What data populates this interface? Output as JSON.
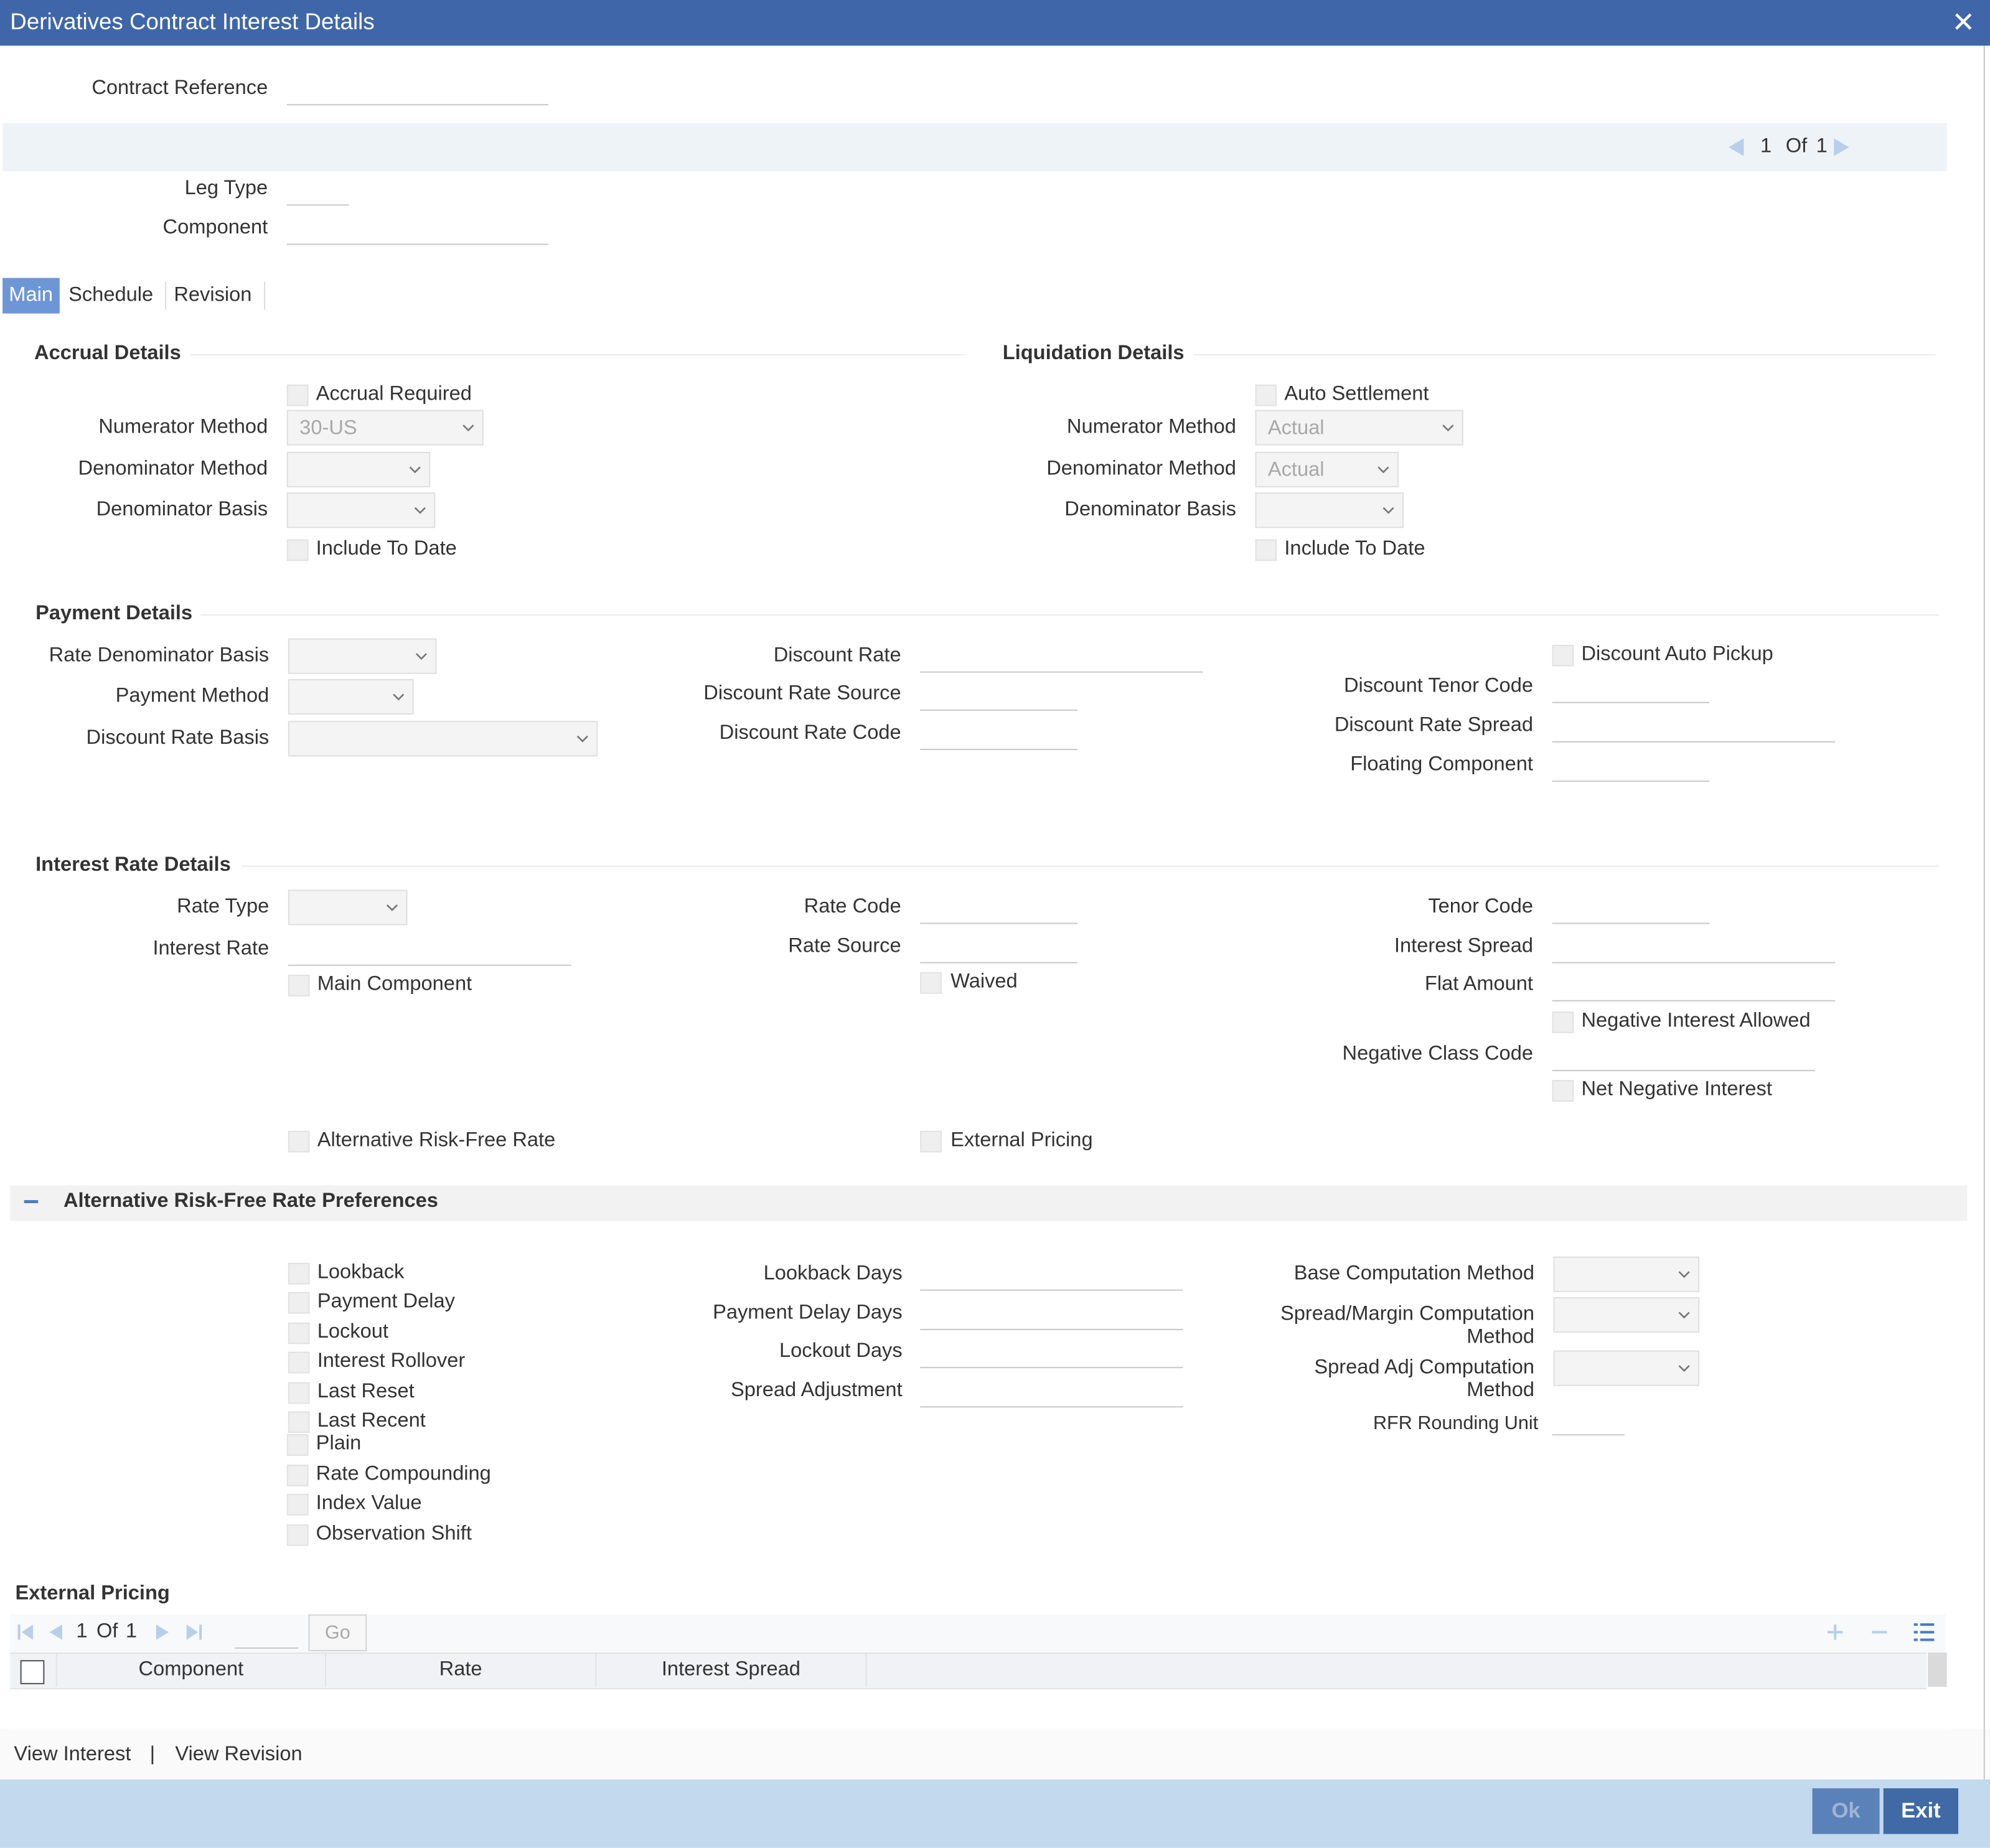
{
  "window": {
    "title": "Derivatives Contract Interest Details",
    "close_glyph": "✕"
  },
  "header": {
    "contract_reference_label": "Contract Reference",
    "leg_type_label": "Leg Type",
    "component_label": "Component",
    "pager": {
      "current": "1",
      "of": "Of",
      "total": "1"
    }
  },
  "tabs": [
    {
      "label": "Main"
    },
    {
      "label": "Schedule"
    },
    {
      "label": "Revision"
    }
  ],
  "accrual": {
    "title": "Accrual Details",
    "accrual_required": "Accrual Required",
    "numerator_method": "Numerator Method",
    "numerator_value": "30-US",
    "denominator_method": "Denominator Method",
    "denominator_basis": "Denominator Basis",
    "include_to_date": "Include To Date"
  },
  "liquidation": {
    "title": "Liquidation Details",
    "auto_settlement": "Auto Settlement",
    "numerator_method": "Numerator Method",
    "numerator_value": "Actual",
    "denominator_method": "Denominator Method",
    "denominator_value": "Actual",
    "denominator_basis": "Denominator Basis",
    "include_to_date": "Include To Date"
  },
  "payment": {
    "title": "Payment Details",
    "rate_denominator_basis": "Rate Denominator Basis",
    "payment_method": "Payment Method",
    "discount_rate_basis": "Discount Rate Basis",
    "discount_rate": "Discount Rate",
    "discount_rate_source": "Discount Rate Source",
    "discount_rate_code": "Discount Rate Code",
    "discount_auto_pickup": "Discount Auto Pickup",
    "discount_tenor_code": "Discount Tenor Code",
    "discount_rate_spread": "Discount Rate Spread",
    "floating_component": "Floating Component"
  },
  "interest": {
    "title": "Interest Rate Details",
    "rate_type": "Rate Type",
    "interest_rate": "Interest Rate",
    "main_component": "Main Component",
    "rate_code": "Rate Code",
    "rate_source": "Rate Source",
    "waived": "Waived",
    "tenor_code": "Tenor Code",
    "interest_spread": "Interest Spread",
    "flat_amount": "Flat Amount",
    "negative_interest_allowed": "Negative Interest Allowed",
    "negative_class_code": "Negative Class Code",
    "net_negative_interest": "Net Negative Interest",
    "alternative_rfr": "Alternative Risk-Free Rate",
    "external_pricing": "External Pricing"
  },
  "rfr": {
    "title": "Alternative Risk-Free Rate Preferences",
    "collapse_glyph": "−",
    "checks": [
      "Lookback",
      "Payment Delay",
      "Lockout",
      "Interest Rollover",
      "Last Reset",
      "Last Recent"
    ],
    "checks2": [
      "Plain",
      "Rate Compounding",
      "Index Value",
      "Observation Shift"
    ],
    "lookback_days": "Lookback Days",
    "payment_delay_days": "Payment Delay Days",
    "lockout_days": "Lockout Days",
    "spread_adjustment": "Spread Adjustment",
    "base_computation_method": "Base Computation Method",
    "spread_margin_l1": "Spread/Margin Computation",
    "spread_margin_l2": "Method",
    "spread_adj_l1": "Spread Adj Computation",
    "spread_adj_l2": "Method",
    "rfr_rounding_unit": "RFR Rounding Unit"
  },
  "external_pricing": {
    "title": "External Pricing",
    "page": "1",
    "of": "Of",
    "total": "1",
    "go": "Go",
    "columns": [
      "Component",
      "Rate",
      "Interest Spread"
    ]
  },
  "footer": {
    "view_interest": "View Interest",
    "separator": "|",
    "view_revision": "View Revision",
    "ok": "Ok",
    "exit": "Exit"
  }
}
